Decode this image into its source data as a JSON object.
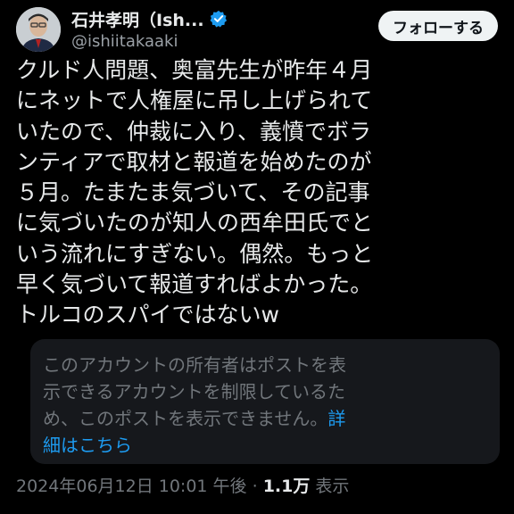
{
  "author": {
    "display_name": "石井孝明（Ish...",
    "handle": "@ishiitakaaki",
    "verified_color": "#1d9bf0"
  },
  "follow_button": {
    "label": "フォローする"
  },
  "post": {
    "lines": [
      "クルド人問題、奥富先生が昨年４月",
      "にネットで人権屋に吊し上げられて",
      "いたので、仲裁に入り、義憤でボラ",
      "ンティアで取材と報道を始めたのが",
      "５月。たまたま気づいて、その記事",
      "に気づいたのが知人の西牟田氏でと",
      "いう流れにすぎない。偶然。もっと",
      "早く気づいて報道すればよかった。",
      "トルコのスパイではないw"
    ]
  },
  "quote_notice": {
    "line1": "このアカウントの所有者はポストを表",
    "line2": "示できるアカウントを制限しているた",
    "line3": "め、このポストを表示できません。",
    "link_part1": "詳",
    "link_part2": "細はこちら",
    "link_color": "#1d9bf0"
  },
  "meta": {
    "timestamp": "2024年06月12日 10:01 午後",
    "separator": "·",
    "views_count": "1.1万",
    "views_label": "表示"
  },
  "icons": {
    "verified": "verified-badge-icon",
    "avatar": "avatar"
  }
}
